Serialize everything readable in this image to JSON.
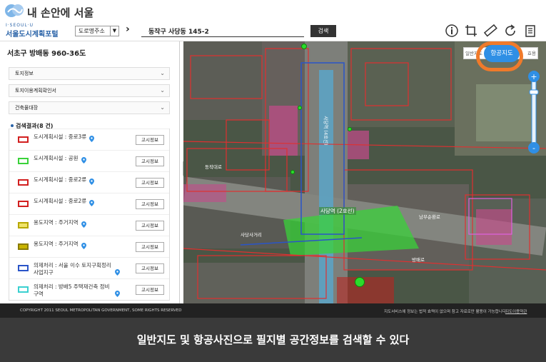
{
  "brand": {
    "title": "내 손안에 서울"
  },
  "header": {
    "site_sub": "I·SEOUL·U",
    "site_title": "서울도시계획포털",
    "select_value": "도로명주소",
    "search_value": "동작구 사당동 145-2",
    "search_button": "검색",
    "icons": [
      "info-icon",
      "crop-icon",
      "ruler-icon",
      "refresh-icon",
      "document-icon"
    ]
  },
  "sidebar": {
    "address": "서초구 방배동 960-36도",
    "accordions": [
      "토지정보",
      "토지이용계획확인서",
      "건축물대장"
    ],
    "results_title": "검색결과(8 건)",
    "notice_label": "고시정보",
    "results": [
      {
        "label": "도시계획시설 : 중로3류",
        "color": "#d21f1f",
        "fill": "#ffffff"
      },
      {
        "label": "도시계획시설 : 공원",
        "color": "#3ad23a",
        "fill": "#ffffff"
      },
      {
        "label": "도시계획시설 : 중로2류",
        "color": "#d21f1f",
        "fill": "#ffffff"
      },
      {
        "label": "도시계획시설 : 중로2류",
        "color": "#d21f1f",
        "fill": "#ffffff"
      },
      {
        "label": "용도지역 : 주거지역",
        "color": "#b8a800",
        "fill": "#f0e46a"
      },
      {
        "label": "용도지역 : 주거지역",
        "color": "#8a7c00",
        "fill": "#c9b400"
      },
      {
        "label": "의제처리 : 서울 이수 토지구획정리사업지구",
        "color": "#2a55c8",
        "fill": "#ffffff"
      },
      {
        "label": "의제처리 : 방배5 주택재건축 정비구역",
        "color": "#3ad0d0",
        "fill": "#ffffff"
      }
    ]
  },
  "map": {
    "toggle_general": "일반지도",
    "toggle_air": "항공지도",
    "toggle_extra": "효용",
    "labels": [
      "사당역 (2호선)",
      "사당역 (4호선)",
      "사당사거리",
      "방배로",
      "동작대로",
      "남부순환로"
    ]
  },
  "footer": {
    "copyright": "COPYRIGHT 2011 SEOUL METROPOLITAN GOVERNMENT, SOME RIGHTS RESERVED",
    "notice": "지도서비스에 정보는 법적 효력이 없으며 참고 자료로만 활용이 가능합니다.",
    "terms": "지도이용약관"
  },
  "caption": "일반지도 및 항공사진으로 필지별 공간정보를 검색할 수 있다",
  "colors": {
    "accent": "#2f8fe5",
    "highlight_ring": "#f07a2a",
    "footer": "#222222",
    "caption_bg": "#3a3a3a"
  }
}
